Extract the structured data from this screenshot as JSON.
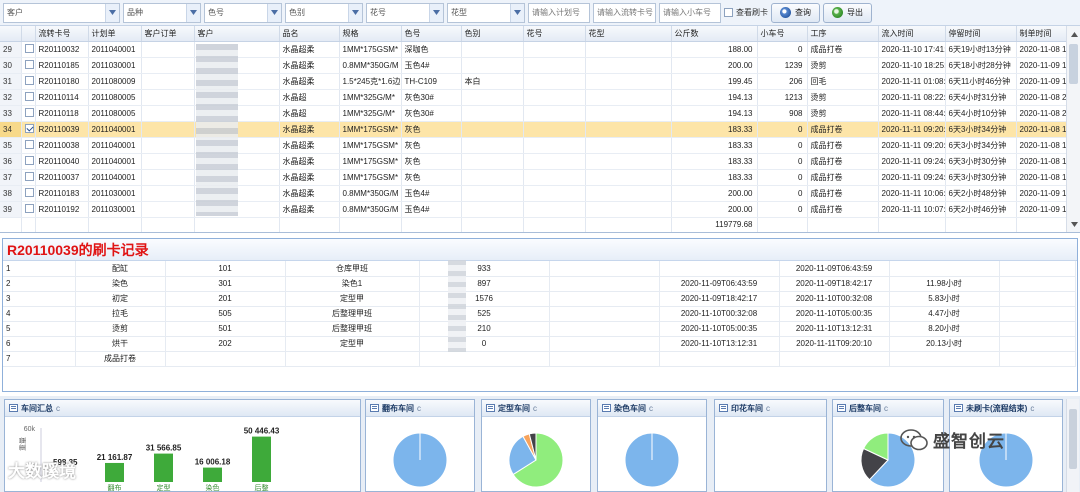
{
  "toolbar": {
    "combos": [
      "客户",
      "品种",
      "色号",
      "色别",
      "花号",
      "花型"
    ],
    "placeholders": {
      "plan_no": "请输入计划号",
      "card_no": "请输入流转卡号",
      "cart_no": "请输入小车号"
    },
    "view_card_label": "查看刷卡",
    "query_label": "查询",
    "export_label": "导出"
  },
  "grid": {
    "headers": [
      "",
      "",
      "流转卡号",
      "计划单",
      "客户订单",
      "客户",
      "品名",
      "规格",
      "色号",
      "色别",
      "花号",
      "花型",
      "公斤数",
      "小车号",
      "工序",
      "流入时间",
      "停留时间",
      "制单时间"
    ],
    "rows": [
      {
        "rn": "29",
        "checked": false,
        "card": "R20110032",
        "plan": "2011040001",
        "order": "",
        "customer": "",
        "name": "水晶超柔",
        "spec": "1MM*175GSM*",
        "color_no": "深咖色",
        "color_type": "",
        "flower_no": "",
        "flower_type": "",
        "kg": "188.00",
        "cart": "0",
        "process": "成品打卷",
        "in_time": "2020-11-10 17:41:",
        "stay": "6天19小时13分钟",
        "created": "2020-11-08 12:07:"
      },
      {
        "rn": "30",
        "checked": false,
        "card": "R20110185",
        "plan": "2011030001",
        "order": "",
        "customer": "",
        "name": "水晶超柔",
        "spec": "0.8MM*350G/M",
        "color_no": "玉色4#",
        "color_type": "",
        "flower_no": "",
        "flower_type": "",
        "kg": "200.00",
        "cart": "1239",
        "process": "烫剪",
        "in_time": "2020-11-10 18:25:",
        "stay": "6天18小时28分钟",
        "created": "2020-11-09 11:51:"
      },
      {
        "rn": "31",
        "checked": false,
        "card": "R20110180",
        "plan": "2011080009",
        "order": "",
        "customer": "",
        "name": "水晶超柔",
        "spec": "1.5*245克*1.6边",
        "color_no": "TH-C109",
        "color_type": "本白",
        "flower_no": "",
        "flower_type": "",
        "kg": "199.45",
        "cart": "206",
        "process": "回毛",
        "in_time": "2020-11-11 01:08:",
        "stay": "6天11小时46分钟",
        "created": "2020-11-09 11:16:"
      },
      {
        "rn": "32",
        "checked": false,
        "card": "R20110114",
        "plan": "2011080005",
        "order": "",
        "customer": "",
        "name": "水晶超",
        "spec": "1MM*325G/M*",
        "color_no": "灰色30#",
        "color_type": "",
        "flower_no": "",
        "flower_type": "",
        "kg": "194.13",
        "cart": "1213",
        "process": "烫剪",
        "in_time": "2020-11-11 08:22:",
        "stay": "6天4小时31分钟",
        "created": "2020-11-08 20:39:"
      },
      {
        "rn": "33",
        "checked": false,
        "card": "R20110118",
        "plan": "2011080005",
        "order": "",
        "customer": "",
        "name": "水晶超",
        "spec": "1MM*325G/M*",
        "color_no": "灰色30#",
        "color_type": "",
        "flower_no": "",
        "flower_type": "",
        "kg": "194.13",
        "cart": "908",
        "process": "烫剪",
        "in_time": "2020-11-11 08:44:",
        "stay": "6天4小时10分钟",
        "created": "2020-11-08 20:39:"
      },
      {
        "rn": "34",
        "checked": true,
        "card": "R20110039",
        "plan": "2011040001",
        "order": "",
        "customer": "",
        "name": "水晶超柔",
        "spec": "1MM*175GSM*",
        "color_no": "灰色",
        "color_type": "",
        "flower_no": "",
        "flower_type": "",
        "kg": "183.33",
        "cart": "0",
        "process": "成品打卷",
        "in_time": "2020-11-11 09:20:",
        "stay": "6天3小时34分钟",
        "created": "2020-11-08 12:09:"
      },
      {
        "rn": "35",
        "checked": false,
        "card": "R20110038",
        "plan": "2011040001",
        "order": "",
        "customer": "",
        "name": "水晶超柔",
        "spec": "1MM*175GSM*",
        "color_no": "灰色",
        "color_type": "",
        "flower_no": "",
        "flower_type": "",
        "kg": "183.33",
        "cart": "0",
        "process": "成品打卷",
        "in_time": "2020-11-11 09:20:",
        "stay": "6天3小时34分钟",
        "created": "2020-11-08 12:09:"
      },
      {
        "rn": "36",
        "checked": false,
        "card": "R20110040",
        "plan": "2011040001",
        "order": "",
        "customer": "",
        "name": "水晶超柔",
        "spec": "1MM*175GSM*",
        "color_no": "灰色",
        "color_type": "",
        "flower_no": "",
        "flower_type": "",
        "kg": "183.33",
        "cart": "0",
        "process": "成品打卷",
        "in_time": "2020-11-11 09:24:",
        "stay": "6天3小时30分钟",
        "created": "2020-11-08 12:09:"
      },
      {
        "rn": "37",
        "checked": false,
        "card": "R20110037",
        "plan": "2011040001",
        "order": "",
        "customer": "",
        "name": "水晶超柔",
        "spec": "1MM*175GSM*",
        "color_no": "灰色",
        "color_type": "",
        "flower_no": "",
        "flower_type": "",
        "kg": "183.33",
        "cart": "0",
        "process": "成品打卷",
        "in_time": "2020-11-11 09:24:",
        "stay": "6天3小时30分钟",
        "created": "2020-11-08 12:09:"
      },
      {
        "rn": "38",
        "checked": false,
        "card": "R20110183",
        "plan": "2011030001",
        "order": "",
        "customer": "",
        "name": "水晶超柔",
        "spec": "0.8MM*350G/M",
        "color_no": "玉色4#",
        "color_type": "",
        "flower_no": "",
        "flower_type": "",
        "kg": "200.00",
        "cart": "0",
        "process": "成品打卷",
        "in_time": "2020-11-11 10:06:",
        "stay": "6天2小时48分钟",
        "created": "2020-11-09 11:51:"
      },
      {
        "rn": "39",
        "checked": false,
        "card": "R20110192",
        "plan": "2011030001",
        "order": "",
        "customer": "",
        "name": "水晶超柔",
        "spec": "0.8MM*350G/M",
        "color_no": "玉色4#",
        "color_type": "",
        "flower_no": "",
        "flower_type": "",
        "kg": "200.00",
        "cart": "0",
        "process": "成品打卷",
        "in_time": "2020-11-11 10:07:",
        "stay": "6天2小时46分钟",
        "created": "2020-11-09 11:51:"
      }
    ],
    "total_kg": "119779.68"
  },
  "record": {
    "title": "R20110039的刷卡记录",
    "rows": [
      {
        "idx": "1",
        "step": "配缸",
        "code": "101",
        "team": "仓库甲班",
        "qty": "933",
        "start": "",
        "end": "2020-11-09T06:43:59",
        "dur": ""
      },
      {
        "idx": "2",
        "step": "染色",
        "code": "301",
        "team": "染色1",
        "qty": "897",
        "start": "2020-11-09T06:43:59",
        "end": "2020-11-09T18:42:17",
        "dur": "11.98小时"
      },
      {
        "idx": "3",
        "step": "初定",
        "code": "201",
        "team": "定型甲",
        "qty": "1576",
        "start": "2020-11-09T18:42:17",
        "end": "2020-11-10T00:32:08",
        "dur": "5.83小时"
      },
      {
        "idx": "4",
        "step": "拉毛",
        "code": "505",
        "team": "后整理甲班",
        "qty": "525",
        "start": "2020-11-10T00:32:08",
        "end": "2020-11-10T05:00:35",
        "dur": "4.47小时"
      },
      {
        "idx": "5",
        "step": "烫剪",
        "code": "501",
        "team": "后整理甲班",
        "qty": "210",
        "start": "2020-11-10T05:00:35",
        "end": "2020-11-10T13:12:31",
        "dur": "8.20小时"
      },
      {
        "idx": "6",
        "step": "烘干",
        "code": "202",
        "team": "定型甲",
        "qty": "0",
        "start": "2020-11-10T13:12:31",
        "end": "2020-11-11T09:20:10",
        "dur": "20.13小时"
      },
      {
        "idx": "7",
        "step": "成品打卷",
        "code": "",
        "team": "",
        "qty": "",
        "start": "",
        "end": "",
        "dur": ""
      }
    ]
  },
  "panels": {
    "refresh_glyph": "c",
    "titles": [
      "车间汇总",
      "翻布车间",
      "定型车间",
      "染色车间",
      "印花车间",
      "后整车间",
      "未刷卡(流程结束)"
    ]
  },
  "chart_data": [
    {
      "type": "bar",
      "title": "车间汇总",
      "categories": [
        "翻布",
        "定型",
        "染色",
        "后整"
      ],
      "values": [
        21161.87,
        31566.85,
        16006.18,
        50446.43
      ],
      "data_labels": [
        "21 161.87",
        "31 566.85",
        "16 006.18",
        "50 446.43"
      ],
      "extra_label": "598.35",
      "ylabel": "重量",
      "ytick": "60k",
      "ylim": [
        0,
        60000
      ],
      "color": "#3eaa3a"
    },
    {
      "type": "pie",
      "title": "翻布车间",
      "values": [
        100
      ],
      "colors": [
        "#7cb5ec"
      ]
    },
    {
      "type": "pie",
      "title": "定型车间",
      "values": [
        66,
        26,
        4,
        4
      ],
      "colors": [
        "#90ed7d",
        "#7cb5ec",
        "#f7a35c",
        "#434348"
      ]
    },
    {
      "type": "pie",
      "title": "染色车间",
      "values": [
        100
      ],
      "colors": [
        "#7cb5ec"
      ]
    },
    {
      "type": "pie",
      "title": "印花车间",
      "values": [],
      "colors": []
    },
    {
      "type": "pie",
      "title": "后整车间",
      "values": [
        62,
        20,
        18
      ],
      "colors": [
        "#7cb5ec",
        "#434348",
        "#90ed7d"
      ]
    },
    {
      "type": "pie",
      "title": "未刷卡(流程结束)",
      "values": [
        100
      ],
      "colors": [
        "#7cb5ec"
      ]
    }
  ],
  "watermarks": {
    "left": "大数蹊境",
    "right": "盛智创云"
  },
  "colors": {
    "selected_row": "#fde5a8",
    "record_title": "#e01414",
    "bar": "#3eaa3a"
  }
}
